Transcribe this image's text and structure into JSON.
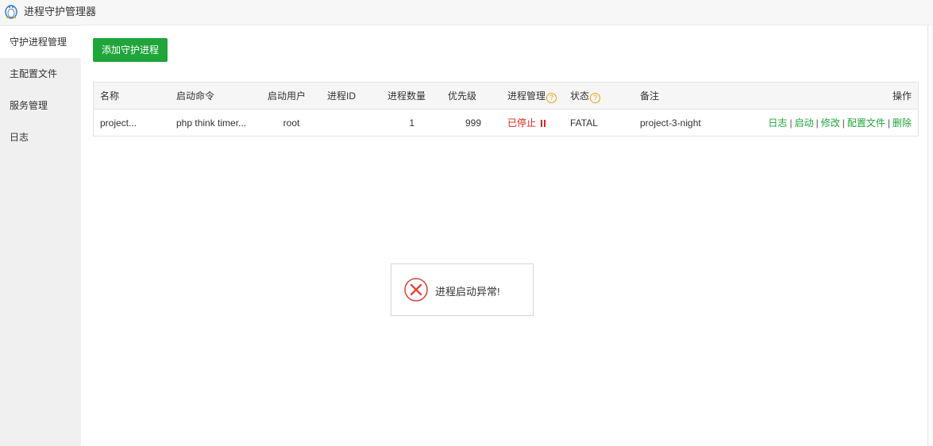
{
  "window": {
    "title": "进程守护管理器"
  },
  "sidebar": {
    "items": [
      {
        "label": "守护进程管理",
        "active": true
      },
      {
        "label": "主配置文件",
        "active": false
      },
      {
        "label": "服务管理",
        "active": false
      },
      {
        "label": "日志",
        "active": false
      }
    ]
  },
  "toolbar": {
    "add_label": "添加守护进程"
  },
  "table": {
    "headers": {
      "name": "名称",
      "command": "启动命令",
      "user": "启动用户",
      "pid": "进程ID",
      "count": "进程数量",
      "priority": "优先级",
      "manage": "进程管理",
      "status": "状态",
      "note": "备注",
      "ops": "操作"
    },
    "help_glyph": "?",
    "rows": [
      {
        "name": "project...",
        "command": "php think timer...",
        "user": "root",
        "pid": "",
        "count": "1",
        "priority": "999",
        "manage": "已停止",
        "status": "FATAL",
        "note": "project-3-night",
        "ops": [
          "日志",
          "启动",
          "修改",
          "配置文件",
          "删除"
        ],
        "ops_sep": "|"
      }
    ]
  },
  "toast": {
    "message": "进程启动异常!",
    "icon": "error-x-icon"
  },
  "colors": {
    "accent": "#20a53a",
    "danger": "#e0241c",
    "help": "#f0a014"
  }
}
